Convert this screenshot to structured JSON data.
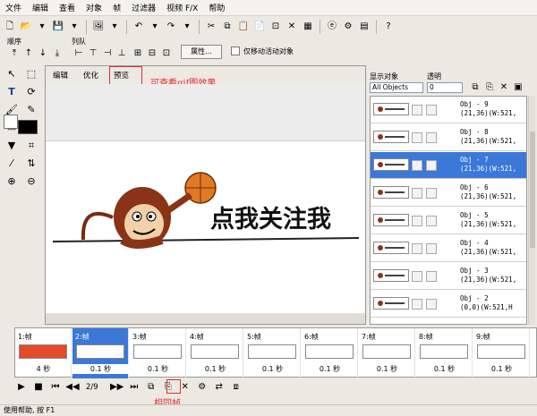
{
  "menu": [
    "文件",
    "编辑",
    "查看",
    "对象",
    "帧",
    "过滤器",
    "视频 F/X",
    "帮助"
  ],
  "toolbar2": {
    "order_label": "顺序",
    "arrange_label": "列队",
    "properties_button": "属性...",
    "move_active_label": "仅移动活动对象"
  },
  "center": {
    "tabs": [
      "编辑",
      "优化",
      "预览"
    ],
    "annotation": "可查看gif图效果",
    "banner_text": "点我关注我"
  },
  "right": {
    "show_label": "显示对象",
    "opacity_label": "透明",
    "filter_value": "All Objects",
    "opacity_value": "0",
    "objects": [
      {
        "name": "Obj - 9",
        "info": "(21,36)(W:521,"
      },
      {
        "name": "Obj - 8",
        "info": "(21,36)(W:521,"
      },
      {
        "name": "Obj - 7",
        "info": "(21,36)(W:521,"
      },
      {
        "name": "Obj - 6",
        "info": "(21,36)(W:521,"
      },
      {
        "name": "Obj - 5",
        "info": "(21,36)(W:521,"
      },
      {
        "name": "Obj - 4",
        "info": "(21,36)(W:521,"
      },
      {
        "name": "Obj - 3",
        "info": "(21,36)(W:521,"
      },
      {
        "name": "Obj - 2",
        "info": "(0,0)(W:521,H"
      }
    ]
  },
  "frames": [
    {
      "label": "1:帧",
      "time": "4 秒"
    },
    {
      "label": "2:帧",
      "time": "0.1 秒"
    },
    {
      "label": "3:帧",
      "time": "0.1 秒"
    },
    {
      "label": "4:帧",
      "time": "0.1 秒"
    },
    {
      "label": "5:帧",
      "time": "0.1 秒"
    },
    {
      "label": "6:帧",
      "time": "0.1 秒"
    },
    {
      "label": "7:帧",
      "time": "0.1 秒"
    },
    {
      "label": "8:帧",
      "time": "0.1 秒"
    },
    {
      "label": "9:帧",
      "time": "0.1 秒"
    }
  ],
  "playbar": {
    "counter": "2/9",
    "same_frame_annotation": "相同帧"
  },
  "status": "使用帮助, 按 F1",
  "colors": {
    "selection": "#3b78d8",
    "annotation": "#e03030",
    "thumb_red": "#e34b2a"
  }
}
